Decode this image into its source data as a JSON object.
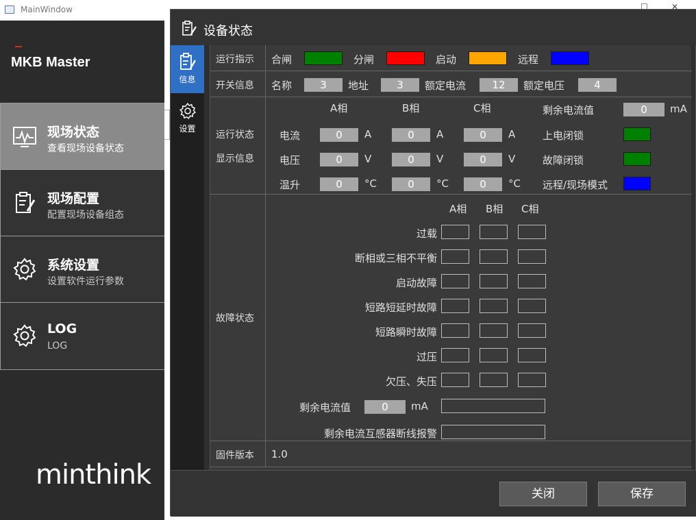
{
  "window": {
    "title": "MainWindow",
    "minimize": "—",
    "maximize": "☐",
    "close": "✕"
  },
  "sidebar": {
    "brand": "MKB Master",
    "items": [
      {
        "title": "现场状态",
        "subtitle": "查看现场设备状态"
      },
      {
        "title": "现场配置",
        "subtitle": "配置现场设备组态"
      },
      {
        "title": "系统设置",
        "subtitle": "设置软件运行参数"
      },
      {
        "title": "LOG",
        "subtitle": "LOG"
      }
    ],
    "logo": "minthink"
  },
  "dialog": {
    "title": "设备状态",
    "tabs": [
      {
        "label": "信息"
      },
      {
        "label": "设置"
      }
    ],
    "run_indicator": {
      "label": "运行指示",
      "items": [
        {
          "name": "合闸",
          "color": "#008000"
        },
        {
          "name": "分闸",
          "color": "#ff0000"
        },
        {
          "name": "启动",
          "color": "#ffa500"
        },
        {
          "name": "远程",
          "color": "#0000ff"
        }
      ]
    },
    "switch_info": {
      "label": "开关信息",
      "name_label": "名称",
      "name_value": "3",
      "addr_label": "地址",
      "addr_value": "3",
      "rated_current_label": "额定电流",
      "rated_current_value": "12",
      "rated_voltage_label": "额定电压",
      "rated_voltage_value": "4"
    },
    "run_status": {
      "label1": "运行状态",
      "label2": "显示信息",
      "phases": [
        "A相",
        "B相",
        "C相"
      ],
      "rows": [
        {
          "name": "电流",
          "unit": "A",
          "values": [
            "0",
            "0",
            "0"
          ]
        },
        {
          "name": "电压",
          "unit": "V",
          "values": [
            "0",
            "0",
            "0"
          ]
        },
        {
          "name": "温升",
          "unit": "°C",
          "values": [
            "0",
            "0",
            "0"
          ]
        }
      ],
      "residual_label": "剩余电流值",
      "residual_value": "0",
      "residual_unit": "mA",
      "indicators": [
        {
          "name": "上电闭锁",
          "color": "#008000"
        },
        {
          "name": "故障闭锁",
          "color": "#008000"
        },
        {
          "name": "远程/现场模式",
          "color": "#0000ff"
        }
      ]
    },
    "fault_status": {
      "label": "故障状态",
      "phases": [
        "A相",
        "B相",
        "C相"
      ],
      "rows": [
        "过载",
        "断相或三相不平衡",
        "启动故障",
        "短路短延时故障",
        "短路瞬时故障",
        "过压",
        "欠压、失压"
      ],
      "residual_label": "剩余电流值",
      "residual_value": "0",
      "residual_unit": "mA",
      "ct_alarm_label": "剩余电流互感器断线报警"
    },
    "firmware": {
      "label": "固件版本",
      "value": "1.0"
    },
    "buttons": {
      "close": "关闭",
      "save": "保存"
    }
  },
  "colors": {
    "active_nav": "#8a8a8a",
    "active_tab": "#2f6fc4",
    "brand_mark": "#d52b1e"
  }
}
